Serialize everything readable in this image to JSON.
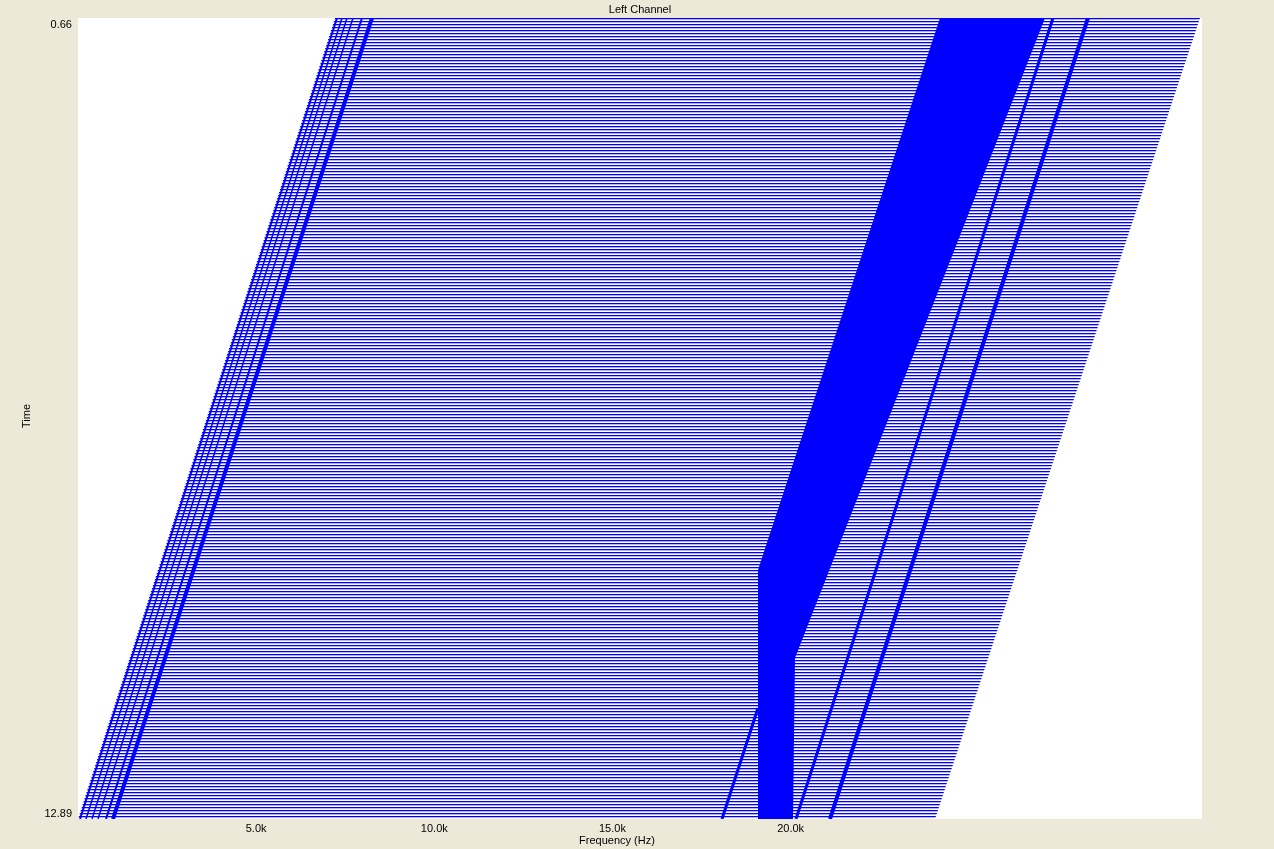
{
  "plot": {
    "title": "Left Channel",
    "y_axis": {
      "label": "Time",
      "top_tick": "0.66",
      "bottom_tick": "12.89"
    },
    "x_axis": {
      "label": "Frequency (Hz)",
      "ticks": [
        "5.0k",
        "10.0k",
        "15.0k",
        "20.0k"
      ]
    }
  }
}
